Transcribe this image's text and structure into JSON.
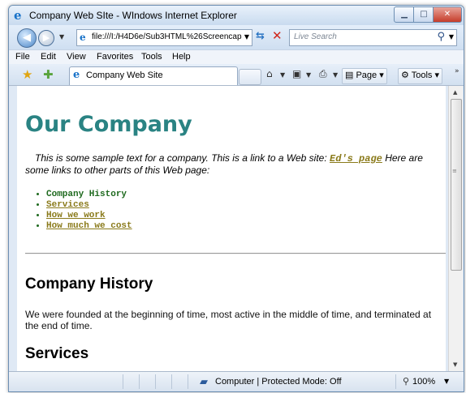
{
  "window": {
    "title": "Company Web SIte - WIndows Internet Explorer"
  },
  "address_bar": {
    "url": "file:///I:/H4D6e/Sub3HTML%26Screencaps",
    "search_placeholder": "Live Search"
  },
  "menu": [
    "File",
    "Edit",
    "View",
    "Favorites",
    "Tools",
    "Help"
  ],
  "tab": {
    "label": "Company Web Site"
  },
  "toolbar": {
    "page_label": "Page",
    "tools_label": "Tools"
  },
  "page": {
    "heading": "Our Company",
    "intro_text": "This is some sample text for a company. This is a link to a Web site:",
    "intro_link": "Ed's page",
    "intro_tail": "Here are some links to other parts of this Web page:",
    "links": [
      "Company History",
      "Services",
      "How we work",
      "How much we cost"
    ],
    "section1_title": "Company History",
    "section1_text": "We were founded at the beginning of time, most active in the middle of time, and terminated at the end of time.",
    "section2_title": "Services"
  },
  "status": {
    "zone_text": "Computer | Protected Mode: Off",
    "zoom": "100%"
  },
  "colors": {
    "heading": "#2a8383",
    "link": "#8a7a1a",
    "list_text": "#1f6a1f"
  }
}
